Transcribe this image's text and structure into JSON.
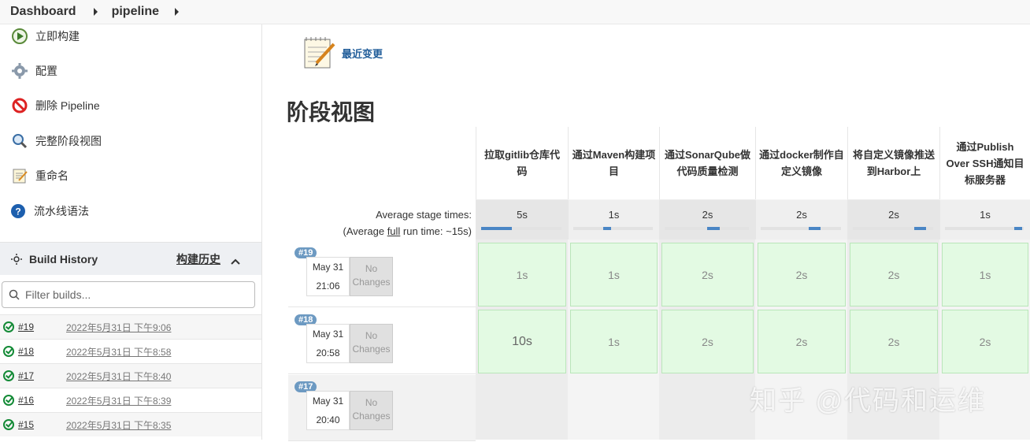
{
  "breadcrumb": {
    "items": [
      "Dashboard",
      "pipeline"
    ]
  },
  "sidebar": {
    "tasks": [
      {
        "label": "立即构建",
        "icon": "build-now-icon"
      },
      {
        "label": "配置",
        "icon": "gear-icon"
      },
      {
        "label": "删除 Pipeline",
        "icon": "delete-icon"
      },
      {
        "label": "完整阶段视图",
        "icon": "search-icon"
      },
      {
        "label": "重命名",
        "icon": "notepad-icon"
      },
      {
        "label": "流水线语法",
        "icon": "help-icon"
      }
    ],
    "build_history": {
      "title": "Build History",
      "trend": "构建历史",
      "filter_placeholder": "Filter builds...",
      "builds": [
        {
          "number": "#19",
          "date": "2022年5月31日 下午9:06"
        },
        {
          "number": "#18",
          "date": "2022年5月31日 下午8:58"
        },
        {
          "number": "#17",
          "date": "2022年5月31日 下午8:40"
        },
        {
          "number": "#16",
          "date": "2022年5月31日 下午8:39"
        },
        {
          "number": "#15",
          "date": "2022年5月31日 下午8:35"
        }
      ]
    }
  },
  "main": {
    "recent_changes": "最近变更",
    "title": "阶段视图",
    "avg_label_1": "Average stage times:",
    "avg_label_2a": "(Average ",
    "avg_label_2b": "full",
    "avg_label_2c": " run time: ~15s)",
    "stages": [
      {
        "name": "拉取gitlib仓库代码",
        "avg": "5s",
        "bar": 0.38
      },
      {
        "name": "通过Maven构建项目",
        "avg": "1s",
        "bar": 0.1
      },
      {
        "name": "通过SonarQube做代码质量检测",
        "avg": "2s",
        "bar": 0.15
      },
      {
        "name": "通过docker制作自定义镜像",
        "avg": "2s",
        "bar": 0.15
      },
      {
        "name": "将自定义镜像推送到Harbor上",
        "avg": "2s",
        "bar": 0.15
      },
      {
        "name": "通过Publish Over SSH通知目标服务器",
        "avg": "1s",
        "bar": 0.1
      }
    ],
    "runs": [
      {
        "badge": "#19",
        "date": "May 31",
        "time": "21:06",
        "changes": [
          "No",
          "Changes"
        ],
        "cells": [
          "1s",
          "1s",
          "2s",
          "2s",
          "2s",
          "1s"
        ]
      },
      {
        "badge": "#18",
        "date": "May 31",
        "time": "20:58",
        "changes": [
          "No",
          "Changes"
        ],
        "cells": [
          "10s",
          "1s",
          "2s",
          "2s",
          "2s",
          "2s"
        ]
      },
      {
        "badge": "#17",
        "date": "May 31",
        "time": "20:40",
        "changes": [
          "No",
          "Changes"
        ],
        "cells": [
          "",
          "",
          "",
          "",
          "",
          ""
        ]
      }
    ]
  },
  "watermark": "知乎 @代码和运维"
}
